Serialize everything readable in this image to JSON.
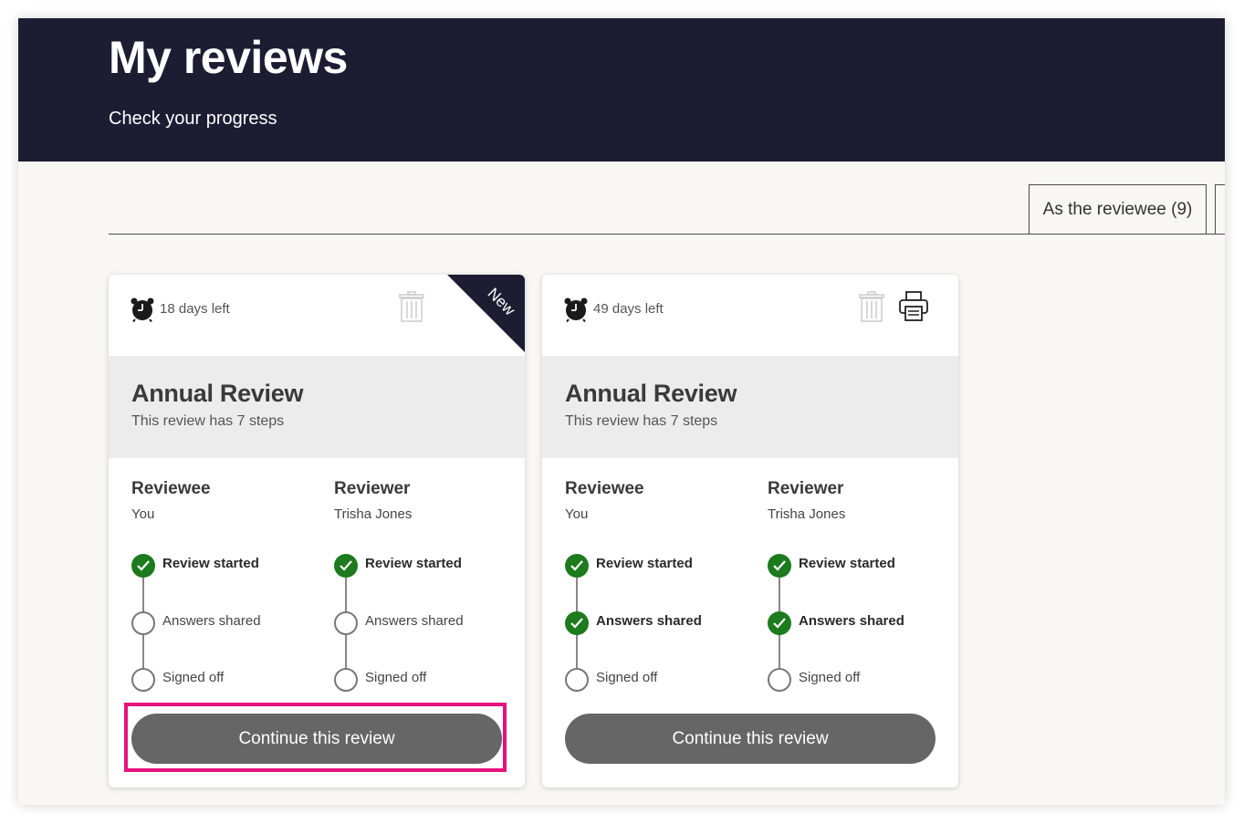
{
  "header": {
    "title": "My reviews",
    "subtitle": "Check your progress"
  },
  "tabs": [
    {
      "label": "As the reviewee (9)",
      "active": true
    }
  ],
  "cards": [
    {
      "days_left": "18 days left",
      "badge": "New",
      "title": "Annual Review",
      "steps_text": "This review has 7 steps",
      "reviewee_heading": "Reviewee",
      "reviewee_name": "You",
      "reviewer_heading": "Reviewer",
      "reviewer_name": "Trisha Jones",
      "reviewee_steps": [
        {
          "label": "Review started",
          "done": true
        },
        {
          "label": "Answers shared",
          "done": false
        },
        {
          "label": "Signed off",
          "done": false
        }
      ],
      "reviewer_steps": [
        {
          "label": "Review started",
          "done": true
        },
        {
          "label": "Answers shared",
          "done": false
        },
        {
          "label": "Signed off",
          "done": false
        }
      ],
      "button_label": "Continue this review"
    },
    {
      "days_left": "49 days left",
      "title": "Annual Review",
      "steps_text": "This review has 7 steps",
      "reviewee_heading": "Reviewee",
      "reviewee_name": "You",
      "reviewer_heading": "Reviewer",
      "reviewer_name": "Trisha Jones",
      "reviewee_steps": [
        {
          "label": "Review started",
          "done": true
        },
        {
          "label": "Answers shared",
          "done": true
        },
        {
          "label": "Signed off",
          "done": false
        }
      ],
      "reviewer_steps": [
        {
          "label": "Review started",
          "done": true
        },
        {
          "label": "Answers shared",
          "done": true
        },
        {
          "label": "Signed off",
          "done": false
        }
      ],
      "button_label": "Continue this review"
    }
  ],
  "colors": {
    "header_bg": "#1c1d33",
    "done": "#1d7a1d",
    "button": "#666666",
    "highlight": "#e6127d"
  }
}
